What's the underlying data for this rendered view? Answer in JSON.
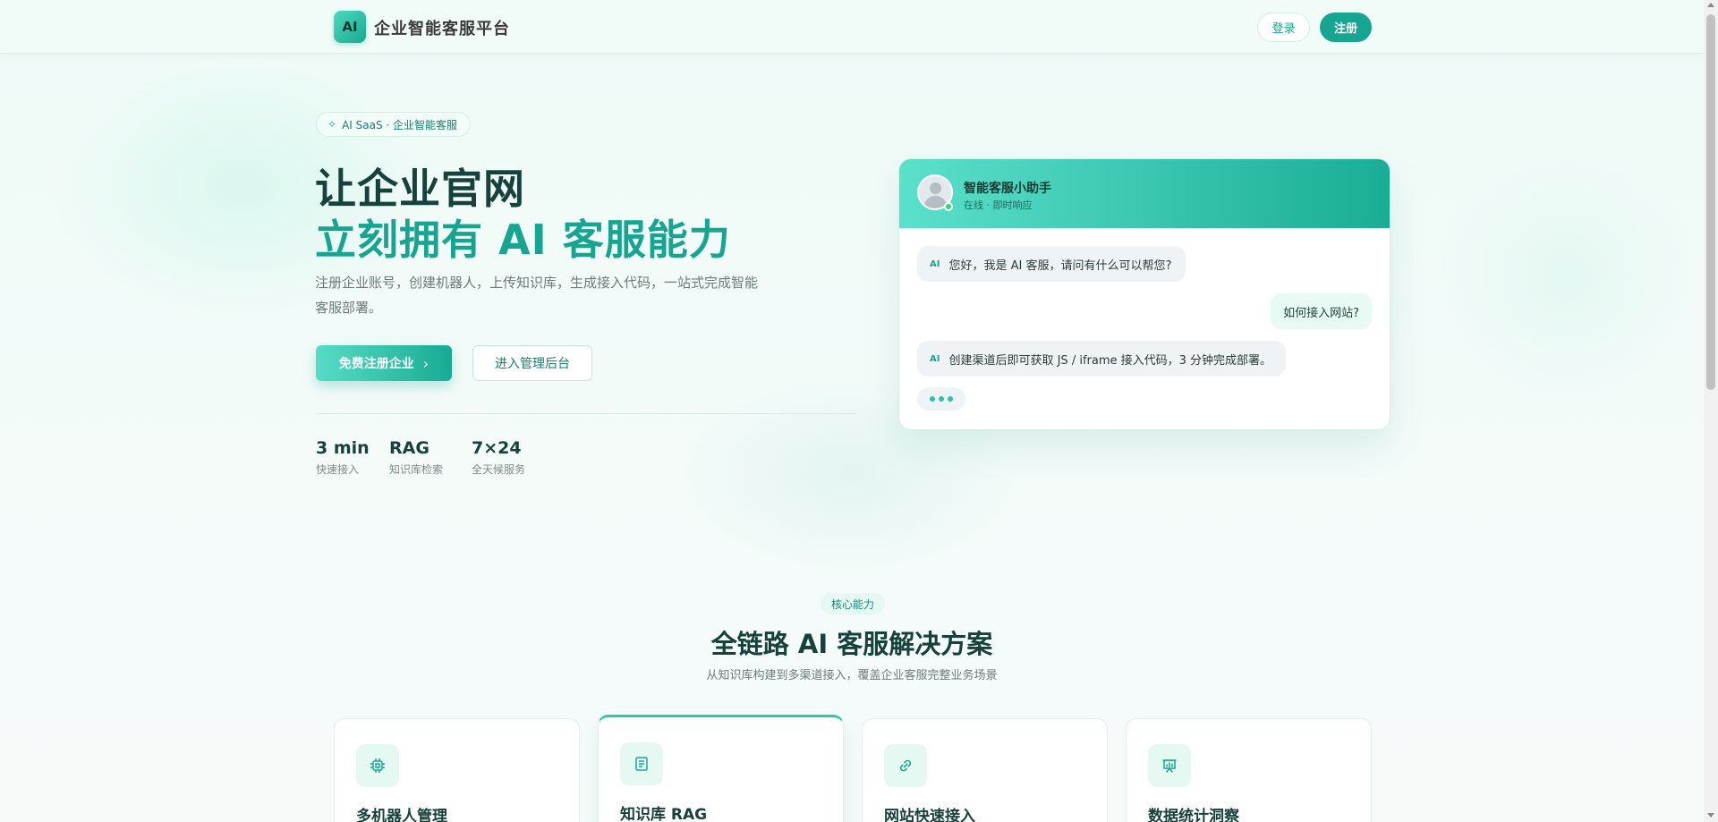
{
  "header": {
    "logo_text": "AI",
    "brand": "企业智能客服平台",
    "login_label": "登录",
    "register_label": "注册"
  },
  "hero": {
    "badge_icon": "sparkle-icon",
    "badge": "AI SaaS · 企业智能客服",
    "title_line1": "让企业官网",
    "title_line2": "立刻拥有 AI 客服能力",
    "description": "注册企业账号，创建机器人，上传知识库，生成接入代码，一站式完成智能客服部署。",
    "primary_button": "免费注册企业",
    "secondary_button": "进入管理后台",
    "stats": [
      {
        "value": "3 min",
        "label": "快速接入"
      },
      {
        "value": "RAG",
        "label": "知识库检索"
      },
      {
        "value": "7×24",
        "label": "全天候服务"
      }
    ]
  },
  "chat": {
    "name": "智能客服小助手",
    "status": "在线 · 即时响应",
    "bot_tag": "AI",
    "messages": [
      {
        "role": "bot",
        "text": "您好，我是 AI 客服，请问有什么可以帮您?"
      },
      {
        "role": "user",
        "text": "如何接入网站?"
      },
      {
        "role": "bot",
        "text": "创建渠道后即可获取 JS / iframe 接入代码，3 分钟完成部署。"
      }
    ]
  },
  "features": {
    "tag": "核心能力",
    "title": "全链路 AI 客服解决方案",
    "subtitle": "从知识库构建到多渠道接入，覆盖企业客服完整业务场景",
    "cards": [
      {
        "icon": "chip-icon",
        "title": "多机器人管理"
      },
      {
        "icon": "book-icon",
        "title": "知识库 RAG"
      },
      {
        "icon": "link-icon",
        "title": "网站快速接入"
      },
      {
        "icon": "presentation-chart-icon",
        "title": "数据统计洞察"
      }
    ]
  },
  "colors": {
    "accent": "#15a590",
    "accent_light": "#57dcc6",
    "title_dark": "#17423b"
  }
}
